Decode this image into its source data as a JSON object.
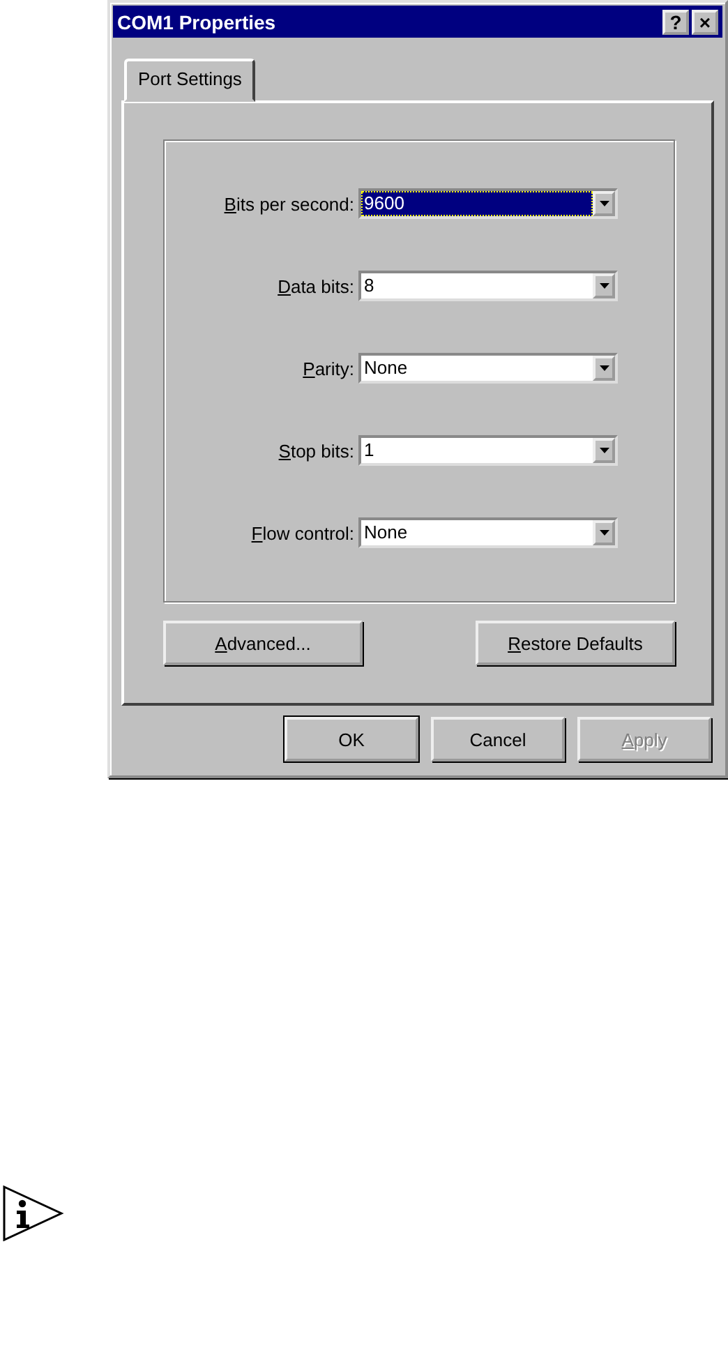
{
  "window": {
    "title": "COM1 Properties",
    "title_buttons": [
      "?",
      "×"
    ]
  },
  "tabs": [
    {
      "label": "Port Settings",
      "selected": true
    }
  ],
  "settings": [
    {
      "label": "Bits per second:",
      "access_key_underlined": true,
      "value": "9600",
      "focused": true
    },
    {
      "label": "Data bits:",
      "access_key_underlined": true,
      "value": "8",
      "focused": false
    },
    {
      "label": "Parity:",
      "access_key_underlined": true,
      "value": "None",
      "focused": false
    },
    {
      "label": "Stop bits:",
      "access_key_underlined": true,
      "value": "1",
      "focused": false
    },
    {
      "label": "Flow control:",
      "access_key_underlined": true,
      "value": "None",
      "focused": false
    }
  ],
  "panel_buttons": [
    {
      "label": "Advanced...",
      "access_key_underlined": true
    },
    {
      "label": "Restore Defaults",
      "access_key_underlined": true
    }
  ],
  "dialog_buttons": [
    {
      "label": "OK",
      "access_key_underlined": false,
      "default": true,
      "disabled": false
    },
    {
      "label": "Cancel",
      "access_key_underlined": false,
      "default": false,
      "disabled": false
    },
    {
      "label": "Apply",
      "access_key_underlined": true,
      "default": false,
      "disabled": true
    }
  ],
  "note": {
    "kind": "info"
  }
}
